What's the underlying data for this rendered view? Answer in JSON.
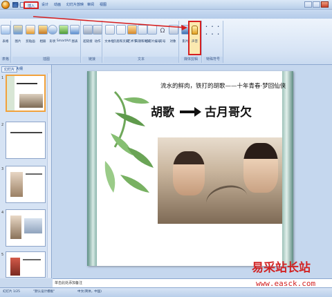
{
  "ribbon": {
    "tabs": [
      "开始",
      "插入",
      "设计",
      "动画",
      "幻灯片放映",
      "审阅",
      "视图"
    ],
    "active_tab": "插入",
    "groups": [
      {
        "label": "表格",
        "buttons": [
          "表格"
        ]
      },
      {
        "label": "插图",
        "buttons": [
          "图片",
          "剪贴画",
          "相册",
          "形状",
          "SmartArt",
          "图表"
        ]
      },
      {
        "label": "链接",
        "buttons": [
          "超链接",
          "动作"
        ]
      },
      {
        "label": "文本",
        "buttons": [
          "文本框",
          "页眉和页脚",
          "艺术字",
          "日期和时间",
          "幻灯片编号",
          "符号",
          "对象"
        ]
      },
      {
        "label": "媒体剪辑",
        "buttons": [
          "影片",
          "声音"
        ]
      },
      {
        "label": "特殊符号",
        "buttons": []
      }
    ]
  },
  "left_pane": {
    "tabs": [
      "幻灯片",
      "大纲"
    ],
    "slide_numbers": [
      "1",
      "2",
      "3",
      "4",
      "5"
    ]
  },
  "slide": {
    "subtitle": "流水的鲜肉，铁打的胡歌——十年青春·梦回仙侠",
    "left_name": "胡歌",
    "right_name": "古月哥欠"
  },
  "notes": {
    "placeholder": "单击此处添加备注"
  },
  "status": {
    "slide_count": "幻灯片 1/25",
    "theme": "\"默认设计模板\"",
    "language": "中文(简体，中国)"
  },
  "watermark": {
    "cn": "易采站长站",
    "url": "www.easck.com"
  },
  "colors": {
    "accent_red": "#d62020",
    "selected_thumb": "#f2a13a"
  }
}
